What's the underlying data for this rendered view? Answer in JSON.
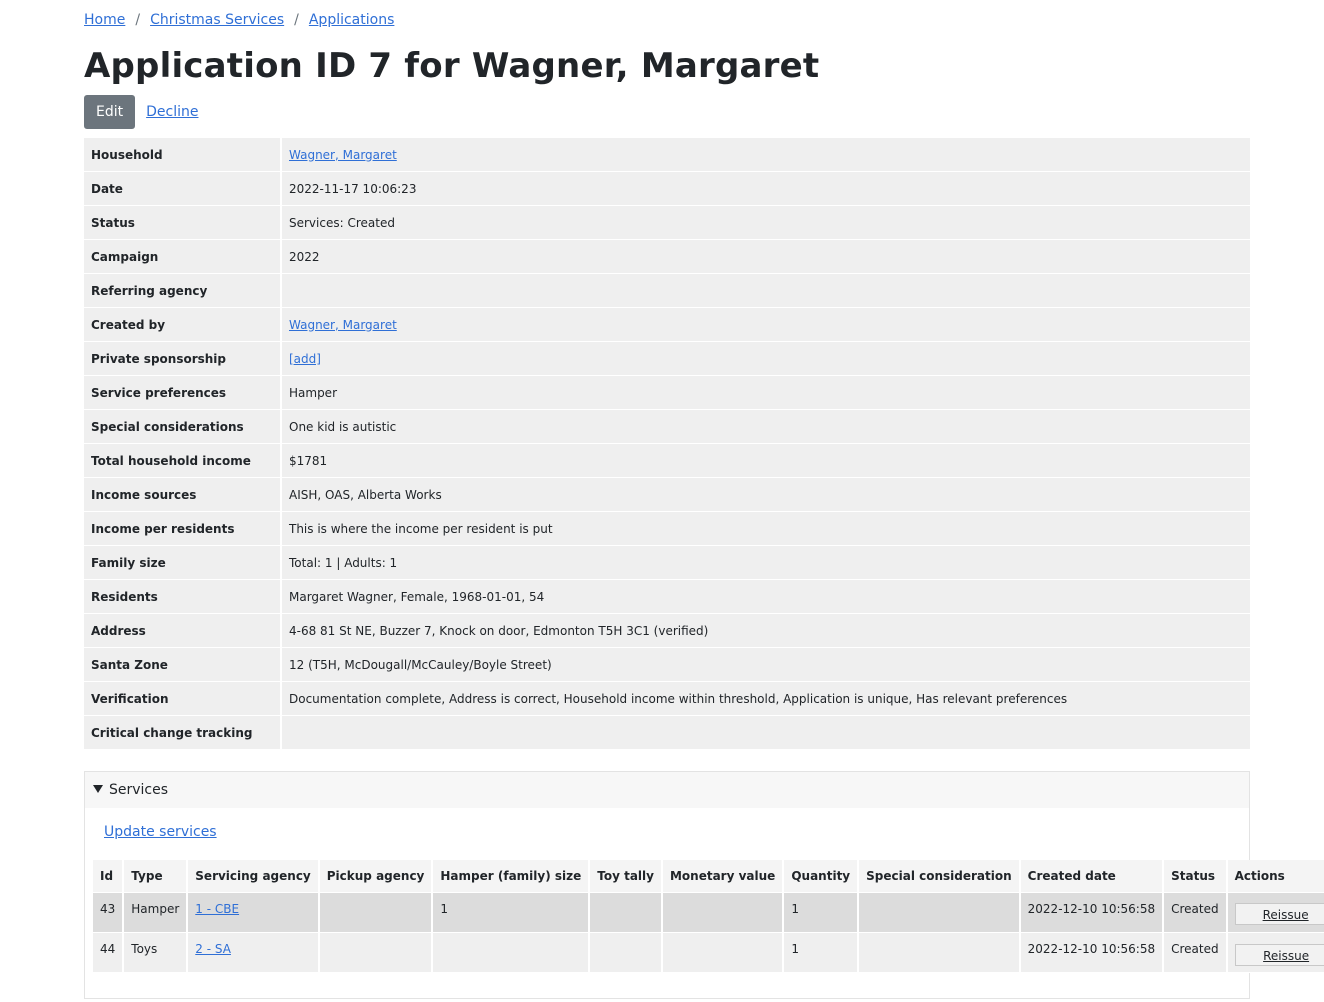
{
  "breadcrumb": {
    "home": "Home",
    "christmas": "Christmas Services",
    "applications": "Applications",
    "sep": "/"
  },
  "title": "Application ID 7 for Wagner, Margaret",
  "actions": {
    "edit": "Edit",
    "decline": "Decline"
  },
  "details": [
    {
      "label": "Household",
      "value": "Wagner, Margaret",
      "link": true
    },
    {
      "label": "Date",
      "value": "2022-11-17 10:06:23"
    },
    {
      "label": "Status",
      "value": "Services: Created"
    },
    {
      "label": "Campaign",
      "value": "2022"
    },
    {
      "label": "Referring agency",
      "value": ""
    },
    {
      "label": "Created by",
      "value": "Wagner, Margaret",
      "link": true
    },
    {
      "label": "Private sponsorship",
      "value": "[add]",
      "link": true
    },
    {
      "label": "Service preferences",
      "value": "Hamper"
    },
    {
      "label": "Special considerations",
      "value": "One kid is autistic"
    },
    {
      "label": "Total household income",
      "value": "$1781"
    },
    {
      "label": "Income sources",
      "value": "AISH, OAS, Alberta Works"
    },
    {
      "label": "Income per residents",
      "value": "This is where the income per resident is put"
    },
    {
      "label": "Family size",
      "value": "Total: 1 | Adults: 1"
    },
    {
      "label": "Residents",
      "value": "Margaret Wagner, Female, 1968-01-01, 54"
    },
    {
      "label": "Address",
      "value": "4-68 81 St NE, Buzzer 7, Knock on door, Edmonton T5H 3C1 (verified)"
    },
    {
      "label": "Santa Zone",
      "value": "12 (T5H, McDougall/McCauley/Boyle Street)"
    },
    {
      "label": "Verification",
      "value": "Documentation complete, Address is correct, Household income within threshold, Application is unique, Has relevant preferences"
    },
    {
      "label": "Critical change tracking",
      "value": ""
    }
  ],
  "services": {
    "heading": "Services",
    "update_link": "Update services",
    "columns": [
      "Id",
      "Type",
      "Servicing agency",
      "Pickup agency",
      "Hamper (family) size",
      "Toy tally",
      "Monetary value",
      "Quantity",
      "Special consideration",
      "Created date",
      "Status",
      "Actions"
    ],
    "rows": [
      {
        "id": "43",
        "type": "Hamper",
        "agency": "1 - CBE",
        "pickup": "",
        "hamper_size": "1",
        "toy_tally": "",
        "monetary": "",
        "quantity": "1",
        "special": "",
        "created": "2022-12-10 10:56:58",
        "status": "Created",
        "action": "Reissue"
      },
      {
        "id": "44",
        "type": "Toys",
        "agency": "2 - SA",
        "pickup": "",
        "hamper_size": "",
        "toy_tally": "",
        "monetary": "",
        "quantity": "1",
        "special": "",
        "created": "2022-12-10 10:56:58",
        "status": "Created",
        "action": "Reissue"
      }
    ]
  }
}
